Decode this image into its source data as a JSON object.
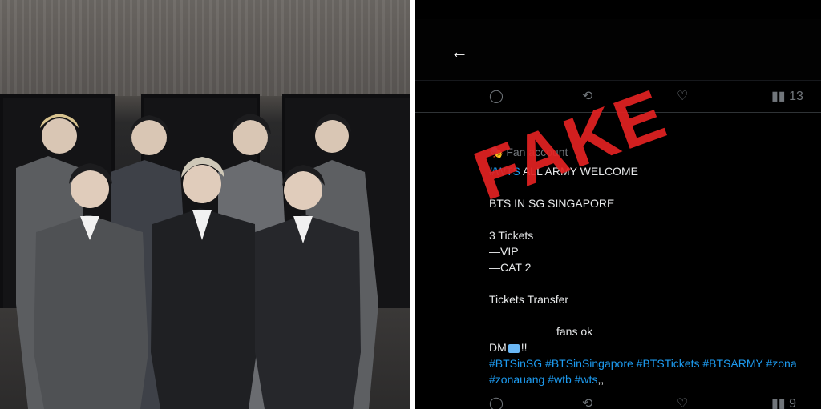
{
  "post": {
    "label": "Fan account",
    "lines": [
      {
        "tag": "#WTS",
        "text": " ALL ARMY WELCOME"
      },
      {
        "text": "BTS IN SG SINGAPORE"
      },
      {
        "text": "3 Tickets"
      },
      {
        "text": "—VIP"
      },
      {
        "text": "—CAT 2"
      },
      {
        "text": "Tickets Transfer"
      },
      {
        "text": "fans ok"
      },
      {
        "text": "DM",
        "suffix": "!!"
      }
    ],
    "hashtags_1": "#BTSinSG #BTSinSingapore #BTSTickets #BTSARMY #zona",
    "hashtags_2": "#zonauang #wtb #wts",
    "hashtags_2_suffix": ",,"
  },
  "stats": {
    "views_top": "13",
    "views_bottom": "9"
  },
  "stamp": {
    "text": "FAKE",
    "color": "#e32222"
  },
  "icons": [
    "back-arrow-icon",
    "reply-icon",
    "retweet-icon",
    "like-icon",
    "views-icon",
    "mask-icon",
    "envelope-icon"
  ]
}
